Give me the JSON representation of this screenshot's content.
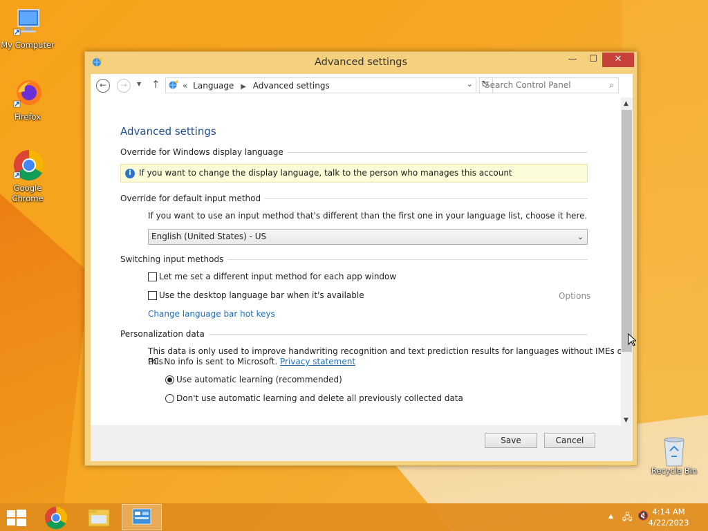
{
  "desktop": {
    "icons": [
      {
        "label": "My Computer"
      },
      {
        "label": "Firefox"
      },
      {
        "label": "Google Chrome"
      },
      {
        "label": "Recycle Bin"
      }
    ]
  },
  "window": {
    "title": "Advanced settings",
    "controls": {
      "minimize": "—",
      "maximize": "☐",
      "close": "✕"
    }
  },
  "address": {
    "overflow": "«",
    "crumbs": [
      "Language",
      "Advanced settings"
    ],
    "search_placeholder": "Search Control Panel"
  },
  "content": {
    "heading": "Advanced settings",
    "display_language": {
      "title": "Override for Windows display language",
      "info": "If you want to change the display language, talk to the person who manages this account"
    },
    "input_method": {
      "title": "Override for default input method",
      "description": "If you want to use an input method that's different than the first one in your language list, choose it here.",
      "selected": "English (United States) - US"
    },
    "switching": {
      "title": "Switching input methods",
      "option1": "Let me set a different input method for each app window",
      "option2": "Use the desktop language bar when it's available",
      "options_link": "Options",
      "hotkeys_link": "Change language bar hot keys"
    },
    "personalization": {
      "title": "Personalization data",
      "description_line1": "This data is only used to improve handwriting recognition and text prediction results for languages without IMEs on this",
      "description_line2": "PC. No info is sent to Microsoft.",
      "privacy_link": "Privacy statement",
      "radio1": "Use automatic learning (recommended)",
      "radio2": "Don't use automatic learning and delete all previously collected data"
    }
  },
  "footer": {
    "save": "Save",
    "cancel": "Cancel"
  },
  "taskbar": {
    "time": "4:14 AM",
    "date": "4/22/2023"
  },
  "colors": {
    "accent": "#1e4f93",
    "link": "#1e6db8",
    "close": "#c7403a"
  }
}
